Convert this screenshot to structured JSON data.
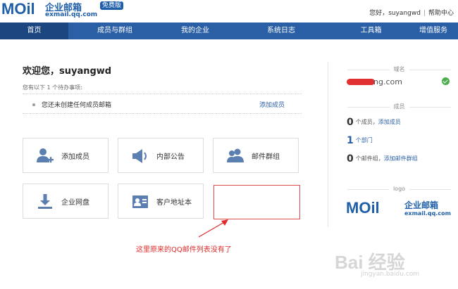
{
  "header": {
    "logo_mail": "MOil",
    "logo_cn": "企业邮箱",
    "logo_badge": "免费版",
    "logo_domain": "exmail.qq.com",
    "greeting": "您好，",
    "username": "suyangwd",
    "separator": "|",
    "help_link": "帮助中心"
  },
  "nav": {
    "items": [
      {
        "label": "首页",
        "active": true
      },
      {
        "label": "成员与群组"
      },
      {
        "label": "我的企业"
      },
      {
        "label": "系统日志"
      },
      {
        "label": "工具箱"
      },
      {
        "label": "增值服务"
      }
    ]
  },
  "main": {
    "welcome": "欢迎您，suyangwd",
    "todo_hint": "您有以下 1 个待办事项:",
    "todo": {
      "text": "您还未创建任何成员邮箱",
      "link": "添加成员"
    },
    "tiles": [
      {
        "label": "添加成员",
        "icon": "add-user-icon"
      },
      {
        "label": "内部公告",
        "icon": "megaphone-icon"
      },
      {
        "label": "邮件群组",
        "icon": "group-icon"
      },
      {
        "label": "企业网盘",
        "icon": "download-icon"
      },
      {
        "label": "客户地址本",
        "icon": "contact-card-icon"
      }
    ],
    "annotation": "这里原来的QQ邮件列表没有了"
  },
  "side": {
    "domain_title": "域名",
    "domain_suffix": "ng.com",
    "members_title": "成员",
    "member_count": "0",
    "member_count_label": "个成员，",
    "add_member_link": "添加成员",
    "dept_count": "1",
    "dept_label": "个部门",
    "group_count": "0",
    "group_label": "个邮件组，",
    "add_group_link": "添加邮件群组",
    "logo_title": "logo",
    "logo_mail": "MOil",
    "logo_cn": "企业邮箱",
    "logo_domain": "exmail.qq.com"
  },
  "watermark": {
    "main": "Bai 经验",
    "sub": "jingyan.baidu.com"
  },
  "colors": {
    "brand": "#2a5fa5",
    "nav_active": "#1b4680",
    "annotation": "#e02b2b",
    "icon": "#5b7fb0"
  }
}
